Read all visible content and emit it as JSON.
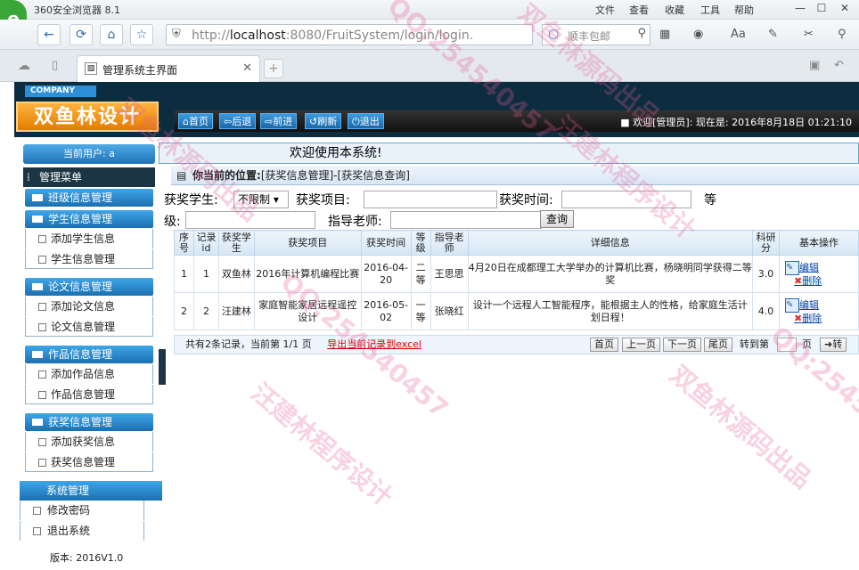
{
  "browser": {
    "title": "360安全浏览器 8.1",
    "menu": [
      "文件",
      "查看",
      "收藏",
      "工具",
      "帮助"
    ],
    "address_plain": "http://",
    "address_host": "localhost",
    "address_rest": ":8080/FruitSystem/login/login.",
    "search_placeholder": "顺丰包邮",
    "tab_title": "管理系统主界面"
  },
  "header": {
    "company": "COMPANY",
    "brand": "双鱼林设计",
    "buttons": [
      "首页",
      "后退",
      "前进",
      "刷新",
      "退出"
    ],
    "welcome": "■ 欢迎[管理员]: 现在是: 2016年8月18日 01:21:10"
  },
  "sidebar": {
    "current_user": "当前用户: a",
    "menu_title": "管理菜单",
    "groups": [
      {
        "title": "班级信息管理",
        "items": []
      },
      {
        "title": "学生信息管理",
        "items": [
          "添加学生信息",
          "学生信息管理"
        ]
      },
      {
        "title": "论文信息管理",
        "items": [
          "添加论文信息",
          "论文信息管理"
        ]
      },
      {
        "title": "作品信息管理",
        "items": [
          "添加作品信息",
          "作品信息管理"
        ]
      },
      {
        "title": "获奖信息管理",
        "items": [
          "添加获奖信息",
          "获奖信息管理"
        ]
      }
    ],
    "system": {
      "title": "系统管理",
      "items": [
        "修改密码",
        "退出系统"
      ]
    },
    "version": "版本: 2016V1.0"
  },
  "main": {
    "welcome_banner": "欢迎使用本系统!",
    "crumb_label": "你当前的位置:",
    "crumb_path": "[获奖信息管理]-[获奖信息查询]",
    "filters": {
      "student_label": "获奖学生:",
      "student_value": "不限制",
      "project_label": "获奖项目:",
      "time_label": "获奖时间:",
      "level_label_a": "等",
      "level_label_b": "级:",
      "teacher_label": "指导老师:",
      "query_button": "查询"
    },
    "table": {
      "headers": [
        "序号",
        "记录id",
        "获奖学生",
        "获奖项目",
        "获奖时间",
        "等级",
        "指导老师",
        "详细信息",
        "科研分",
        "基本操作"
      ],
      "rows": [
        [
          "1",
          "1",
          "双鱼林",
          "2016年计算机编程比赛",
          "2016-04-20",
          "二等",
          "王思思",
          "4月20日在成都理工大学举办的计算机比赛，杨晓明同学获得二等奖",
          "3.0"
        ],
        [
          "2",
          "2",
          "汪建林",
          "家庭智能家居远程遥控设计",
          "2016-05-02",
          "一等",
          "张晓红",
          "设计一个远程人工智能程序，能根据主人的性格，给家庭生活计划日程！",
          "4.0"
        ]
      ],
      "edit_label": "编辑",
      "delete_label": "删除"
    },
    "pager": {
      "summary": "共有2条记录，当前第 1/1 页",
      "export": "导出当前记录到excel",
      "first": "首页",
      "prev": "上一页",
      "next": "下一页",
      "last": "尾页",
      "goto_label": "转到第",
      "page_unit": "页",
      "go": "➜转"
    }
  },
  "watermarks": [
    "双鱼林源码出品",
    "QQ:254540457",
    "汪建林程序设计",
    "双鱼林源码出品",
    "QQ:254540457",
    "汪建林程序设计",
    "QQ:254540457",
    "双鱼林源码出品"
  ]
}
